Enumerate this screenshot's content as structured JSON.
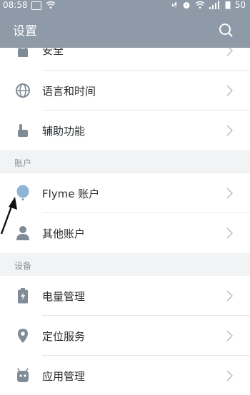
{
  "status_bar": {
    "time": "08:58",
    "battery": "50"
  },
  "app_bar": {
    "title": "设置"
  },
  "items_top": [
    {
      "label": "安全",
      "icon": "lock-icon"
    },
    {
      "label": "语言和时间",
      "icon": "globe-icon"
    },
    {
      "label": "辅助功能",
      "icon": "hand-pointer-icon"
    }
  ],
  "sections": [
    {
      "title": "账户",
      "items": [
        {
          "label": "Flyme 账户",
          "icon": "balloon-icon"
        },
        {
          "label": "其他账户",
          "icon": "person-icon"
        }
      ]
    },
    {
      "title": "设备",
      "items": [
        {
          "label": "电量管理",
          "icon": "battery-icon"
        },
        {
          "label": "定位服务",
          "icon": "location-pin-icon"
        },
        {
          "label": "应用管理",
          "icon": "app-manager-icon"
        }
      ]
    }
  ],
  "colors": {
    "app_bar": "#8e9aa7",
    "icon": "#7f8c97",
    "text": "#2a2e31",
    "section_text": "#8a9096",
    "background": "#f1f3f5"
  }
}
